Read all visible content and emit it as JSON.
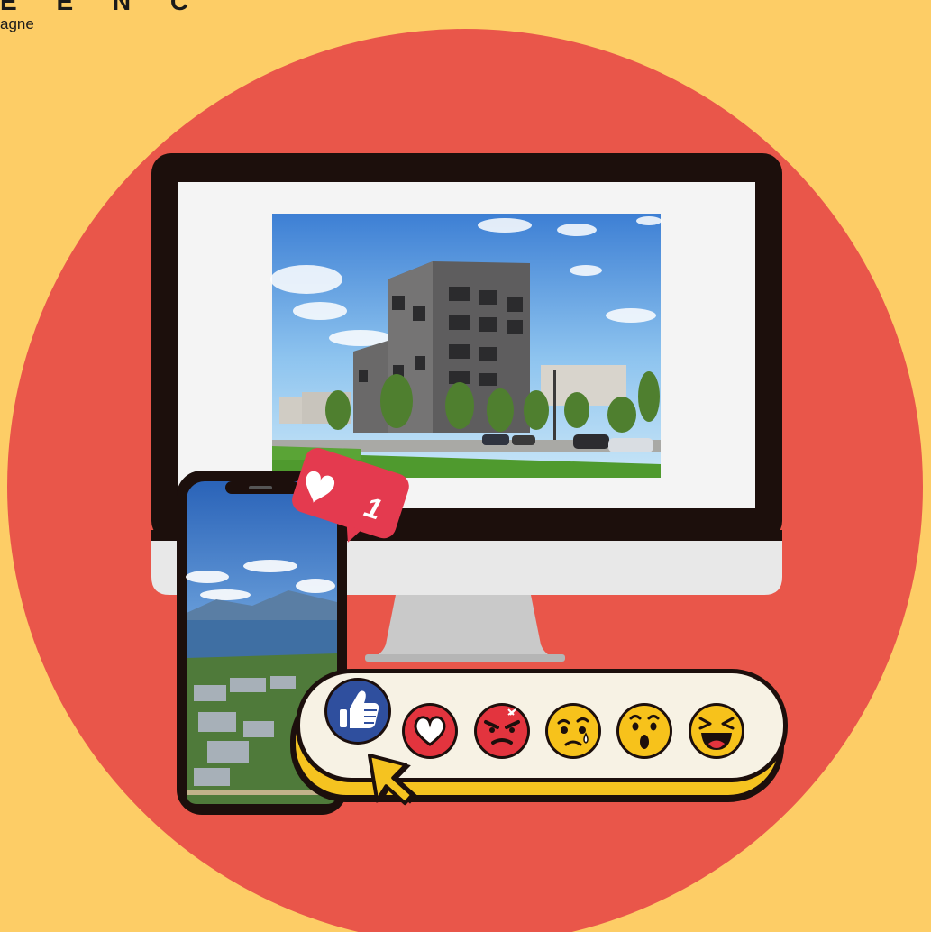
{
  "corner_text": {
    "top_fragment": "E E N C",
    "sub_fragment": "agne"
  },
  "notification": {
    "icon": "heart-icon",
    "count": "1",
    "color": "#e43a4f"
  },
  "reactions": [
    {
      "name": "like",
      "icon": "thumbs-up-icon",
      "color": "#2f4f9e",
      "selected": true
    },
    {
      "name": "love",
      "icon": "heart-icon",
      "color": "#e3343e"
    },
    {
      "name": "angry",
      "icon": "angry-face-icon",
      "color": "#e3343e"
    },
    {
      "name": "sad",
      "icon": "crying-face-icon",
      "color": "#f7c21b"
    },
    {
      "name": "wow",
      "icon": "surprised-face-icon",
      "color": "#f7c21b"
    },
    {
      "name": "haha",
      "icon": "laughing-face-icon",
      "color": "#f7c21b"
    }
  ],
  "colors": {
    "background": "#fdcd66",
    "circle": "#e9564a",
    "monitor_bezel": "#1c0f0c",
    "screen": "#f4f4f4",
    "reaction_bar": "#f7f2e4",
    "reaction_bar_shadow": "#f5c320",
    "cursor": "#f5c320"
  }
}
